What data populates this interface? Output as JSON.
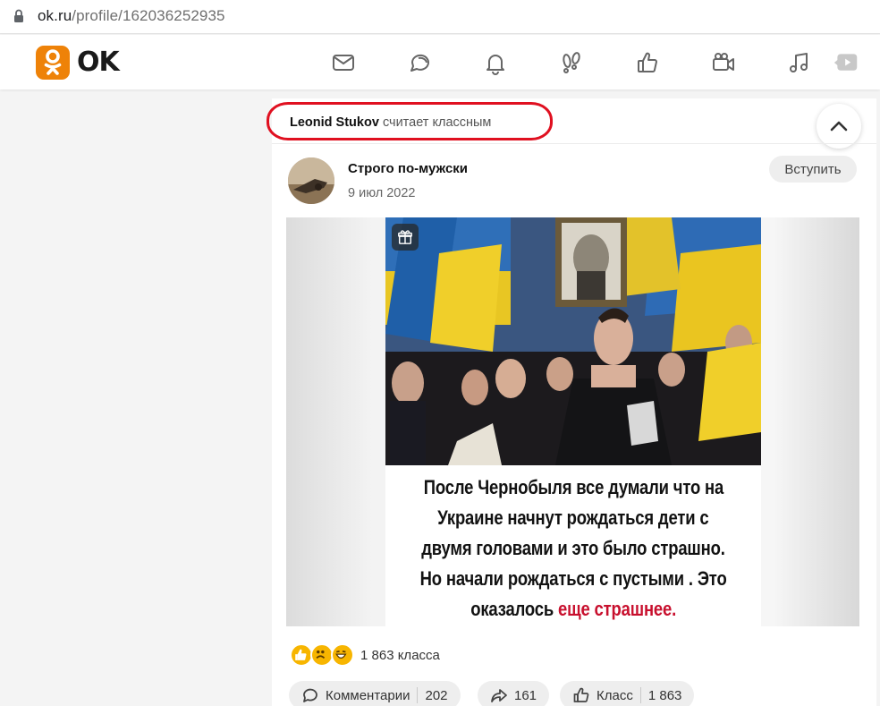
{
  "browser": {
    "url_host": "ok.ru",
    "url_path": "/profile/162036252935"
  },
  "header": {
    "logo_text": "OK",
    "brand_color": "#ee8208",
    "nav_icons": [
      "mail-icon",
      "discussions-icon",
      "notifications-icon",
      "guests-icon",
      "likes-icon",
      "video-icon",
      "music-icon",
      "video-play-icon"
    ]
  },
  "post": {
    "liked_by": "Leonid Stukov",
    "liked_action": "считает классным",
    "group_name": "Строго по-мужски",
    "date": "9 июл 2022",
    "join_label": "Вступить",
    "caption": {
      "line1": "После Чернобыля все думали что на",
      "line2": "Украине начнут рождаться дети с",
      "line3": "двумя головами и это было страшно.",
      "line4": "Но начали рождаться с пустыми . Это",
      "line5_plain": "оказалось ",
      "line5_red": "еще страшнее."
    },
    "reactions": {
      "emojis": [
        "like-emoji",
        "sad-emoji",
        "laugh-emoji"
      ],
      "count_label": "1 863 класса"
    },
    "actions": {
      "comments_label": "Комментарии",
      "comments_count": "202",
      "shares_count": "161",
      "class_label": "Класс",
      "class_count": "1 863"
    },
    "highlight_color": "#e01020"
  }
}
